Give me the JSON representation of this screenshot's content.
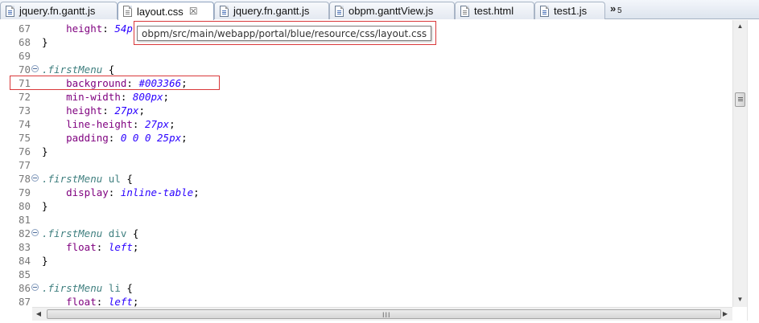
{
  "tabs": [
    {
      "label": "jquery.fn.gantt.js",
      "icon": "js-file-icon",
      "active": false
    },
    {
      "label": "layout.css",
      "icon": "css-file-icon",
      "active": true,
      "close": "☒"
    },
    {
      "label": "jquery.fn.gantt.js",
      "icon": "js-file-icon",
      "active": false
    },
    {
      "label": "obpm.ganttView.js",
      "icon": "js-file-icon",
      "active": false
    },
    {
      "label": "test.html",
      "icon": "html-file-icon",
      "active": false
    },
    {
      "label": "test1.js",
      "icon": "js-file-icon",
      "active": false
    }
  ],
  "overflow": {
    "chevron": "»",
    "count": "5"
  },
  "tooltip": {
    "text": "obpm/src/main/webapp/portal/blue/resource/css/layout.css"
  },
  "lines": [
    {
      "num": "67",
      "fold": false,
      "parts": [
        {
          "t": "    ",
          "c": "plain"
        },
        {
          "t": "height",
          "c": "prop"
        },
        {
          "t": ": ",
          "c": "plain"
        },
        {
          "t": "54p",
          "c": "val"
        }
      ]
    },
    {
      "num": "68",
      "fold": false,
      "parts": [
        {
          "t": "}",
          "c": "plain"
        }
      ]
    },
    {
      "num": "69",
      "fold": false,
      "parts": []
    },
    {
      "num": "70",
      "fold": true,
      "parts": [
        {
          "t": ".firstMenu",
          "c": "selector"
        },
        {
          "t": " {",
          "c": "plain"
        }
      ]
    },
    {
      "num": "71",
      "fold": false,
      "parts": [
        {
          "t": "    ",
          "c": "plain"
        },
        {
          "t": "background",
          "c": "prop"
        },
        {
          "t": ": ",
          "c": "plain"
        },
        {
          "t": "#003366",
          "c": "val"
        },
        {
          "t": ";",
          "c": "plain"
        }
      ]
    },
    {
      "num": "72",
      "fold": false,
      "parts": [
        {
          "t": "    ",
          "c": "plain"
        },
        {
          "t": "min-width",
          "c": "prop"
        },
        {
          "t": ": ",
          "c": "plain"
        },
        {
          "t": "800px",
          "c": "val"
        },
        {
          "t": ";",
          "c": "plain"
        }
      ]
    },
    {
      "num": "73",
      "fold": false,
      "parts": [
        {
          "t": "    ",
          "c": "plain"
        },
        {
          "t": "height",
          "c": "prop"
        },
        {
          "t": ": ",
          "c": "plain"
        },
        {
          "t": "27px",
          "c": "val"
        },
        {
          "t": ";",
          "c": "plain"
        }
      ]
    },
    {
      "num": "74",
      "fold": false,
      "parts": [
        {
          "t": "    ",
          "c": "plain"
        },
        {
          "t": "line-height",
          "c": "prop"
        },
        {
          "t": ": ",
          "c": "plain"
        },
        {
          "t": "27px",
          "c": "val"
        },
        {
          "t": ";",
          "c": "plain"
        }
      ]
    },
    {
      "num": "75",
      "fold": false,
      "parts": [
        {
          "t": "    ",
          "c": "plain"
        },
        {
          "t": "padding",
          "c": "prop"
        },
        {
          "t": ": ",
          "c": "plain"
        },
        {
          "t": "0 0 0 25px",
          "c": "val"
        },
        {
          "t": ";",
          "c": "plain"
        }
      ]
    },
    {
      "num": "76",
      "fold": false,
      "parts": [
        {
          "t": "}",
          "c": "plain"
        }
      ]
    },
    {
      "num": "77",
      "fold": false,
      "parts": []
    },
    {
      "num": "78",
      "fold": true,
      "parts": [
        {
          "t": ".firstMenu",
          "c": "selector"
        },
        {
          "t": " ",
          "c": "plain"
        },
        {
          "t": "ul",
          "c": "tagname"
        },
        {
          "t": " {",
          "c": "plain"
        }
      ]
    },
    {
      "num": "79",
      "fold": false,
      "parts": [
        {
          "t": "    ",
          "c": "plain"
        },
        {
          "t": "display",
          "c": "prop"
        },
        {
          "t": ": ",
          "c": "plain"
        },
        {
          "t": "inline-table",
          "c": "val"
        },
        {
          "t": ";",
          "c": "plain"
        }
      ]
    },
    {
      "num": "80",
      "fold": false,
      "parts": [
        {
          "t": "}",
          "c": "plain"
        }
      ]
    },
    {
      "num": "81",
      "fold": false,
      "parts": []
    },
    {
      "num": "82",
      "fold": true,
      "parts": [
        {
          "t": ".firstMenu",
          "c": "selector"
        },
        {
          "t": " ",
          "c": "plain"
        },
        {
          "t": "div",
          "c": "tagname"
        },
        {
          "t": " {",
          "c": "plain"
        }
      ]
    },
    {
      "num": "83",
      "fold": false,
      "parts": [
        {
          "t": "    ",
          "c": "plain"
        },
        {
          "t": "float",
          "c": "prop"
        },
        {
          "t": ": ",
          "c": "plain"
        },
        {
          "t": "left",
          "c": "val"
        },
        {
          "t": ";",
          "c": "plain"
        }
      ]
    },
    {
      "num": "84",
      "fold": false,
      "parts": [
        {
          "t": "}",
          "c": "plain"
        }
      ]
    },
    {
      "num": "85",
      "fold": false,
      "parts": []
    },
    {
      "num": "86",
      "fold": true,
      "parts": [
        {
          "t": ".firstMenu",
          "c": "selector"
        },
        {
          "t": " ",
          "c": "plain"
        },
        {
          "t": "li",
          "c": "tagname"
        },
        {
          "t": " {",
          "c": "plain"
        }
      ]
    },
    {
      "num": "87",
      "fold": false,
      "parts": [
        {
          "t": "    ",
          "c": "plain"
        },
        {
          "t": "float",
          "c": "prop"
        },
        {
          "t": ": ",
          "c": "plain"
        },
        {
          "t": "left",
          "c": "val"
        },
        {
          "t": ";",
          "c": "plain"
        }
      ]
    }
  ],
  "scrollbar": {
    "up": "▲",
    "down": "▼",
    "left": "◀",
    "right": "▶",
    "grip": "III"
  },
  "colors": {
    "highlight": "#d9383a",
    "property": "#7f007f",
    "value": "#2a00ff",
    "selector": "#3f7f7f"
  }
}
